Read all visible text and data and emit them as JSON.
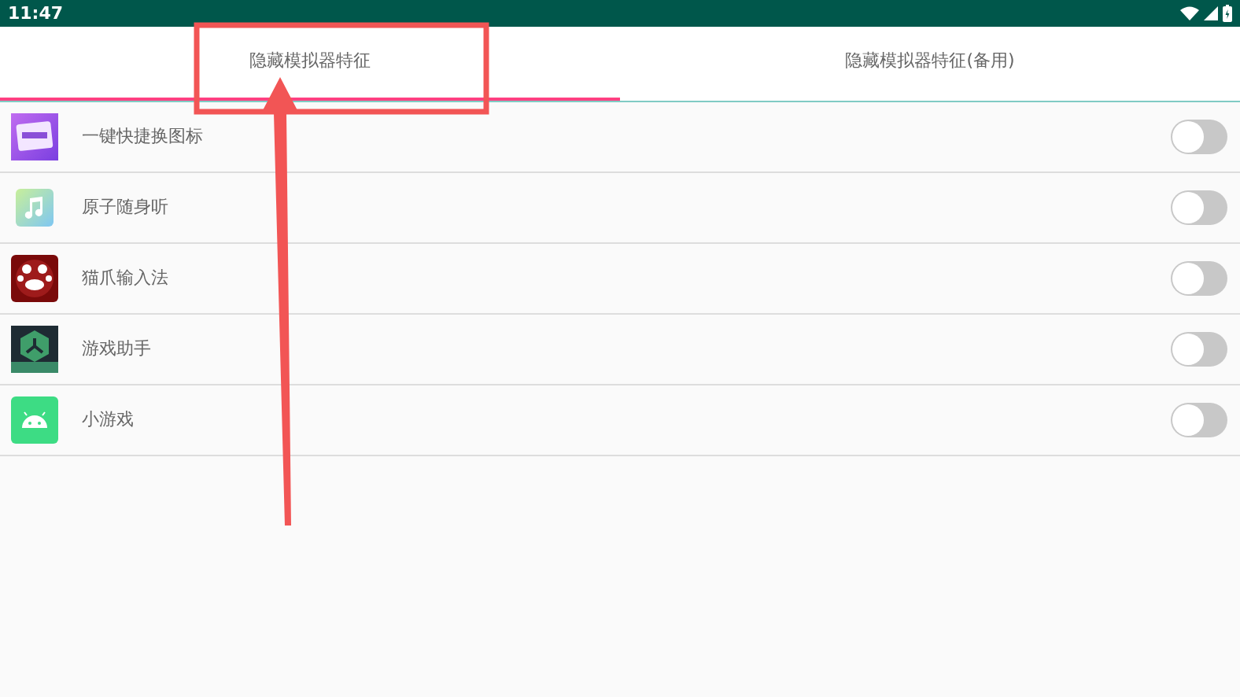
{
  "status_bar": {
    "time": "11:47"
  },
  "tabs": [
    {
      "label": "隐藏模拟器特征",
      "selected": true
    },
    {
      "label": "隐藏模拟器特征(备用)",
      "selected": false
    }
  ],
  "apps": [
    {
      "name": "一键快捷换图标",
      "kind": "purple",
      "on": false
    },
    {
      "name": "原子随身听",
      "kind": "music",
      "on": false
    },
    {
      "name": "猫爪输入法",
      "kind": "paw",
      "on": false
    },
    {
      "name": "游戏助手",
      "kind": "game",
      "on": false
    },
    {
      "name": "小游戏",
      "kind": "android",
      "on": false
    }
  ]
}
